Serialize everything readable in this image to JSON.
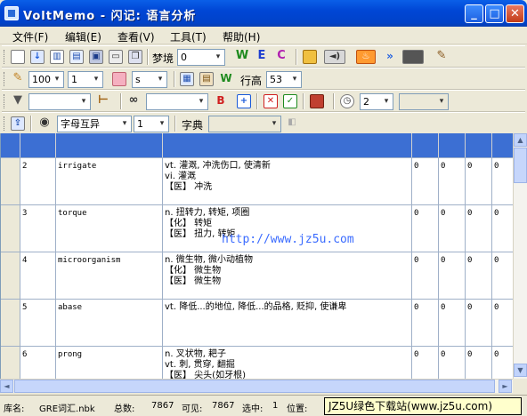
{
  "window": {
    "title": "VoltMemo - 闪记: 语言分析",
    "min": "_",
    "max": "□",
    "close": "✕"
  },
  "menu": [
    "文件(F)",
    "编辑(E)",
    "查看(V)",
    "工具(T)",
    "帮助(H)"
  ],
  "toolbar1": {
    "mode_label": "梦境",
    "mode_value": "0",
    "w": "W",
    "e": "E",
    "c": "C"
  },
  "toolbar2": {
    "size_value": "100",
    "weight_value": "1",
    "style_value": "s",
    "row_height_label": "行高",
    "row_height_value": "53"
  },
  "toolbar3": {
    "filter_value": "",
    "group_value": "",
    "color_label": "B",
    "timer_value": "2",
    "extra_value": ""
  },
  "toolbar4": {
    "sort_value": "字母互异",
    "sort_count": "1",
    "dict_label": "字典",
    "dict_value": ""
  },
  "rows": [
    {
      "num": "2",
      "word": "irrigate",
      "def": "vt. 灌溉, 冲洗伤口, 使清新\nvi. 灌溉\n【医】 冲洗",
      "c1": "0",
      "c2": "0",
      "c3": "0",
      "c4": "0"
    },
    {
      "num": "3",
      "word": "torque",
      "def": "n. 扭转力, 转矩, 项圈\n【化】 转矩\n【医】 扭力, 转矩",
      "c1": "0",
      "c2": "0",
      "c3": "0",
      "c4": "0"
    },
    {
      "num": "4",
      "word": "microorganism",
      "def": "n. 微生物, 微小动植物\n【化】 微生物\n【医】 微生物",
      "c1": "0",
      "c2": "0",
      "c3": "0",
      "c4": "0"
    },
    {
      "num": "5",
      "word": "abase",
      "def": "vt. 降低...的地位, 降低...的品格, 贬抑, 使谦卑",
      "c1": "0",
      "c2": "0",
      "c3": "0",
      "c4": "0"
    },
    {
      "num": "6",
      "word": "prong",
      "def": "n. 叉状物, 耙子\nvt. 刺, 贯穿, 翻掘\n【医】 尖头(如牙根)",
      "c1": "0",
      "c2": "0",
      "c3": "0",
      "c4": "0"
    }
  ],
  "watermark": "http://www.jz5u.com",
  "status": {
    "lib_label": "库名:",
    "lib_value": "GRE词汇.nbk",
    "total_label": "总数:",
    "total_value": "7867",
    "visible_label": "可见:",
    "visible_value": "7867",
    "selected_label": "选中:",
    "selected_value": "1",
    "position_label": "位置:",
    "site": "JZ5U绿色下载站(www.jz5u.com)"
  },
  "colors": {
    "header_blue": "#3c6fd3",
    "title_blue": "#0046d5"
  }
}
